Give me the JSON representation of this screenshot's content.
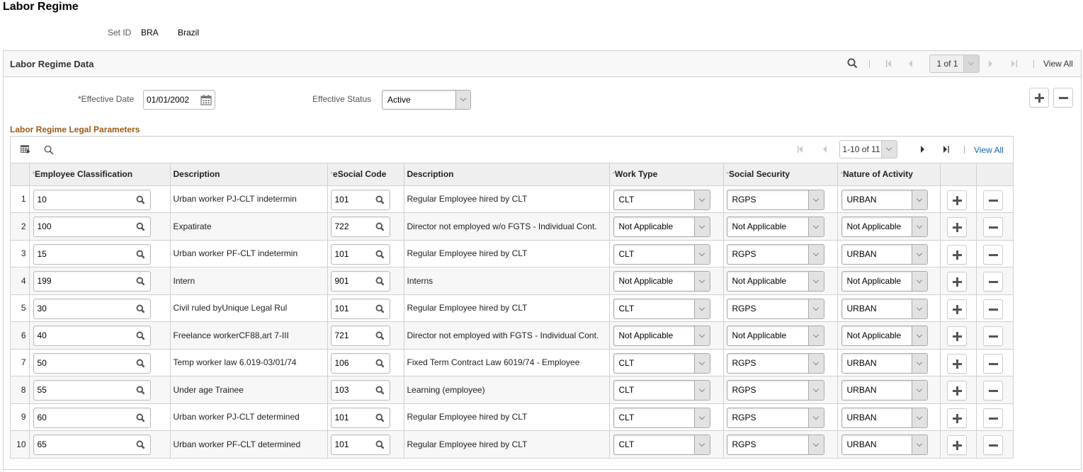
{
  "page": {
    "title": "Labor Regime",
    "setid_label": "Set ID",
    "setid_value": "BRA",
    "setid_description": "Brazil"
  },
  "section": {
    "title": "Labor Regime Data",
    "pager_text": "1 of 1",
    "view_all": "View All",
    "effective_date_label": "*Effective Date",
    "effective_date": "01/01/2002",
    "effective_status_label": "Effective Status",
    "effective_status": "Active"
  },
  "grid": {
    "title": "Labor Regime Legal Parameters",
    "pager_text": "1-10 of 11",
    "view_all": "View All",
    "columns": {
      "employee_classification": "Employee Classification",
      "description": "Description",
      "esocial_code": "eSocial Code",
      "esocial_description": "Description",
      "work_type": "Work Type",
      "social_security": "Social Security",
      "nature_of_activity": "Nature of Activity"
    },
    "rows": [
      {
        "num": "1",
        "emp_class": "10",
        "desc": "Urban worker PJ-CLT indetermin",
        "esocial": "101",
        "esocial_desc": "Regular Employee hired by CLT",
        "work_type": "CLT",
        "social_security": "RGPS",
        "nature": "URBAN"
      },
      {
        "num": "2",
        "emp_class": "100",
        "desc": "Expatirate",
        "esocial": "722",
        "esocial_desc": "Director not employed w/o FGTS - Individual Cont.",
        "work_type": "Not Applicable",
        "social_security": "Not Applicable",
        "nature": "Not Applicable"
      },
      {
        "num": "3",
        "emp_class": "15",
        "desc": "Urban worker PF-CLT indetermin",
        "esocial": "101",
        "esocial_desc": "Regular Employee hired by CLT",
        "work_type": "CLT",
        "social_security": "RGPS",
        "nature": "URBAN"
      },
      {
        "num": "4",
        "emp_class": "199",
        "desc": "Intern",
        "esocial": "901",
        "esocial_desc": "Interns",
        "work_type": "Not Applicable",
        "social_security": "Not Applicable",
        "nature": "Not Applicable"
      },
      {
        "num": "5",
        "emp_class": "30",
        "desc": "Civil ruled byUnique Legal Rul",
        "esocial": "101",
        "esocial_desc": "Regular Employee hired by CLT",
        "work_type": "CLT",
        "social_security": "RGPS",
        "nature": "URBAN"
      },
      {
        "num": "6",
        "emp_class": "40",
        "desc": "Freelance workerCF88,art 7-III",
        "esocial": "721",
        "esocial_desc": "Director not employed with FGTS - Individual Cont.",
        "work_type": "Not Applicable",
        "social_security": "Not Applicable",
        "nature": "Not Applicable"
      },
      {
        "num": "7",
        "emp_class": "50",
        "desc": "Temp worker law 6.019-03/01/74",
        "esocial": "106",
        "esocial_desc": "Fixed Term Contract Law 6019/74 - Employee",
        "work_type": "CLT",
        "social_security": "RGPS",
        "nature": "URBAN"
      },
      {
        "num": "8",
        "emp_class": "55",
        "desc": "Under age Trainee",
        "esocial": "103",
        "esocial_desc": "Learning (employee)",
        "work_type": "CLT",
        "social_security": "RGPS",
        "nature": "URBAN"
      },
      {
        "num": "9",
        "emp_class": "60",
        "desc": "Urban worker PJ-CLT determined",
        "esocial": "101",
        "esocial_desc": "Regular Employee hired by CLT",
        "work_type": "CLT",
        "social_security": "RGPS",
        "nature": "URBAN"
      },
      {
        "num": "10",
        "emp_class": "65",
        "desc": "Urban worker PF-CLT determined",
        "esocial": "101",
        "esocial_desc": "Regular Employee hired by CLT",
        "work_type": "CLT",
        "social_security": "RGPS",
        "nature": "URBAN"
      }
    ]
  },
  "icons": {
    "search": "search-icon",
    "first": "first-page-icon",
    "prev": "previous-page-icon",
    "next": "next-page-icon",
    "last": "last-page-icon",
    "calendar": "calendar-icon",
    "personalize": "personalize-grid-icon",
    "lookup": "lookup-icon",
    "add": "add-row-icon",
    "delete": "delete-row-icon"
  },
  "colors": {
    "grid_title": "#9b5b14",
    "link": "#1a5fa8",
    "header_bg": "#efefef",
    "alt_row_bg": "#f7f7f7"
  }
}
